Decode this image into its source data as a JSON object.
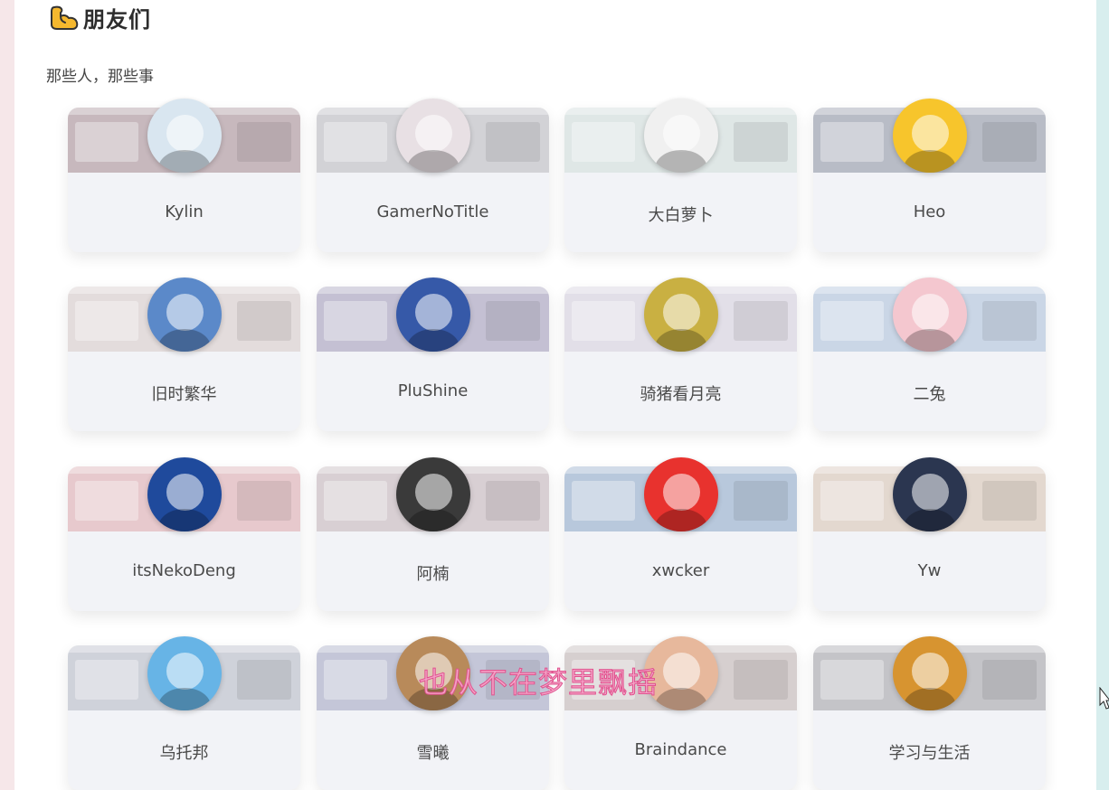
{
  "section": {
    "title": "朋友们",
    "subtitle": "那些人，那些事"
  },
  "icon": {
    "name": "flexed-biceps-icon",
    "color": "#f5b82e"
  },
  "friends": [
    {
      "name": "Kylin",
      "avatar_color": "#d9e6f0",
      "shot_color": "#c7b8bd"
    },
    {
      "name": "GamerNoTitle",
      "avatar_color": "#e8e0e4",
      "shot_color": "#d2d2d6"
    },
    {
      "name": "大白萝卜",
      "avatar_color": "#f0f0f0",
      "shot_color": "#dfe7e6"
    },
    {
      "name": "Heo",
      "avatar_color": "#f7c52c",
      "shot_color": "#b8bcc6"
    },
    {
      "name": "旧时繁华",
      "avatar_color": "#5b89c9",
      "shot_color": "#e3dcdc"
    },
    {
      "name": "PluShine",
      "avatar_color": "#3659a8",
      "shot_color": "#c4c0d3"
    },
    {
      "name": "骑猪看月亮",
      "avatar_color": "#c9b042",
      "shot_color": "#e2dfe8"
    },
    {
      "name": "二兔",
      "avatar_color": "#f4c7cf",
      "shot_color": "#cad6e6"
    },
    {
      "name": "itsNekoDeng",
      "avatar_color": "#1f4a9c",
      "shot_color": "#e7c9cd"
    },
    {
      "name": "阿楠",
      "avatar_color": "#3a3a3a",
      "shot_color": "#d8cfd3"
    },
    {
      "name": "xwcker",
      "avatar_color": "#e8322e",
      "shot_color": "#b8c8dc"
    },
    {
      "name": "Yw",
      "avatar_color": "#2b3650",
      "shot_color": "#e3d8cf"
    },
    {
      "name": "乌托邦",
      "avatar_color": "#67b4e6",
      "shot_color": "#cfd2da"
    },
    {
      "name": "雪曦",
      "avatar_color": "#b88a5a",
      "shot_color": "#c4c6d8"
    },
    {
      "name": "Braindance",
      "avatar_color": "#e7b89c",
      "shot_color": "#d6cfcf"
    },
    {
      "name": "学习与生活",
      "avatar_color": "#d79430",
      "shot_color": "#c4c4c8"
    }
  ],
  "lyric_overlay": "也从不在梦里飘摇"
}
